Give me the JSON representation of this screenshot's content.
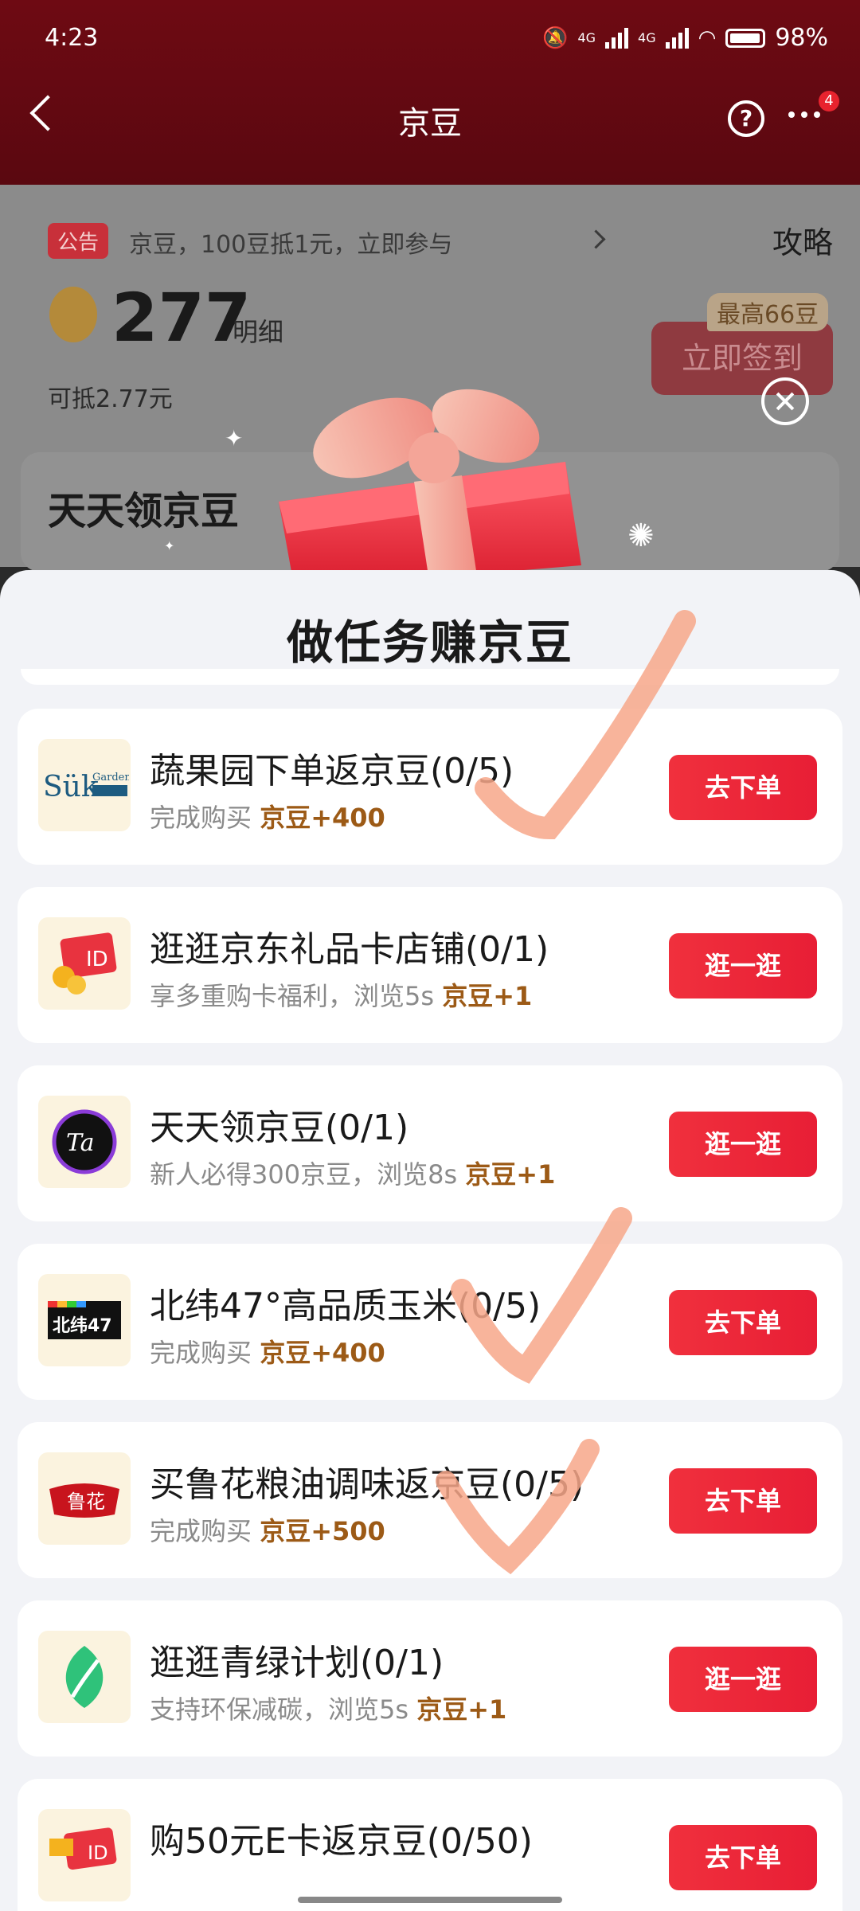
{
  "status_bar": {
    "time": "4:23",
    "network1": "4G",
    "network2": "4G",
    "battery": "98%"
  },
  "nav": {
    "title": "京豆",
    "notification_count": "4"
  },
  "page": {
    "notice_tag": "公告",
    "notice_text": "京豆，100豆抵1元，立即参与",
    "strategy": "攻略",
    "bean_count": "277",
    "detail": "明细",
    "offset_text": "可抵2.77元",
    "sign_badge": "最高66豆",
    "sign_button": "立即签到",
    "daily_title": "天天领京豆"
  },
  "sheet": {
    "title": "做任务赚京豆",
    "tasks": [
      {
        "title": "蔬果园下单返京豆(0/5)",
        "sub": "完成购买",
        "reward": "京豆+400",
        "button": "去下单",
        "logo": "Sük 蔬果园"
      },
      {
        "title": "逛逛京东礼品卡店铺(0/1)",
        "sub": "享多重购卡福利，浏览5s",
        "reward": "京豆+1",
        "button": "逛一逛",
        "logo": "ID"
      },
      {
        "title": "天天领京豆(0/1)",
        "sub": "新人必得300京豆，浏览8s",
        "reward": "京豆+1",
        "button": "逛一逛",
        "logo": "Ta"
      },
      {
        "title": "北纬47°高品质玉米(0/5)",
        "sub": "完成购买",
        "reward": "京豆+400",
        "button": "去下单",
        "logo": "北纬47°"
      },
      {
        "title": "买鲁花粮油调味返京豆(0/5)",
        "sub": "完成购买",
        "reward": "京豆+500",
        "button": "去下单",
        "logo": "鲁花"
      },
      {
        "title": "逛逛青绿计划(0/1)",
        "sub": "支持环保减碳，浏览5s",
        "reward": "京豆+1",
        "button": "逛一逛",
        "logo": "leaf"
      },
      {
        "title": "购50元E卡返京豆(0/50)",
        "sub": "",
        "reward": "",
        "button": "去下单",
        "logo": "ID"
      }
    ]
  },
  "colors": {
    "accent": "#e81e35",
    "reward": "#9c5a16",
    "header": "#6e0a13"
  }
}
